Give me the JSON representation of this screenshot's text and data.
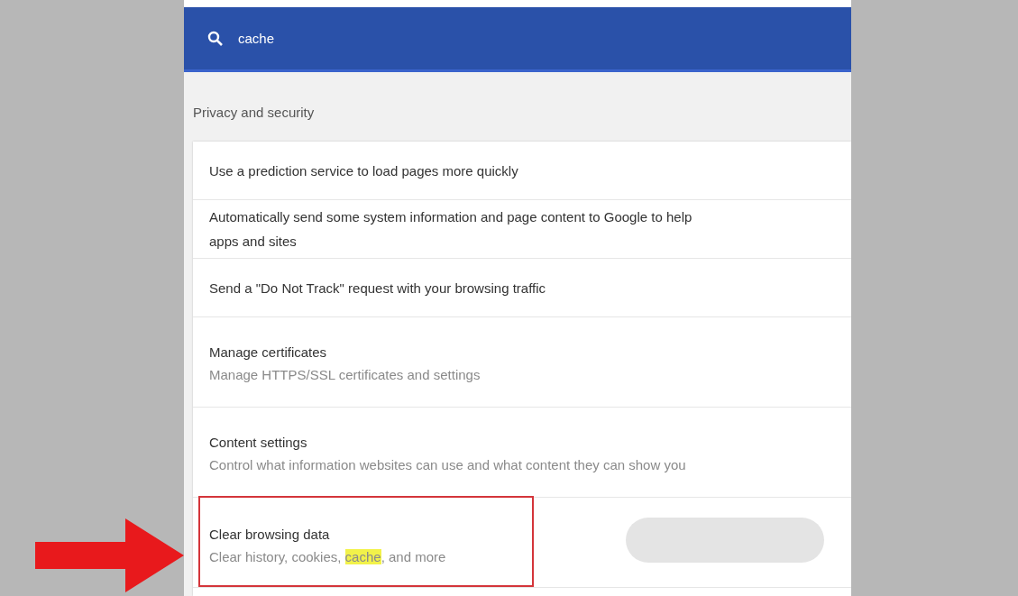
{
  "search": {
    "value": "cache"
  },
  "section": {
    "title": "Privacy and security"
  },
  "rows": [
    {
      "title": "Use a prediction service to load pages more quickly"
    },
    {
      "title": "Automatically send some system information and page content to Google to help",
      "title_line2": "apps and sites"
    },
    {
      "title": "Send a \"Do Not Track\" request with your browsing traffic"
    },
    {
      "title": "Manage certificates",
      "subtitle": [
        {
          "text": "Manage HTTPS/SSL certificates and settings",
          "highlighted": false
        }
      ]
    },
    {
      "title": "Content settings",
      "subtitle": [
        {
          "text": "Control what information websites can use and what content they can show you",
          "highlighted": false
        }
      ]
    },
    {
      "title": "Clear browsing data",
      "subtitle": [
        {
          "text": "Clear history, cookies, ",
          "highlighted": false
        },
        {
          "text": "cache",
          "highlighted": true
        },
        {
          "text": ", and more",
          "highlighted": false
        }
      ],
      "annotated": true
    }
  ]
}
